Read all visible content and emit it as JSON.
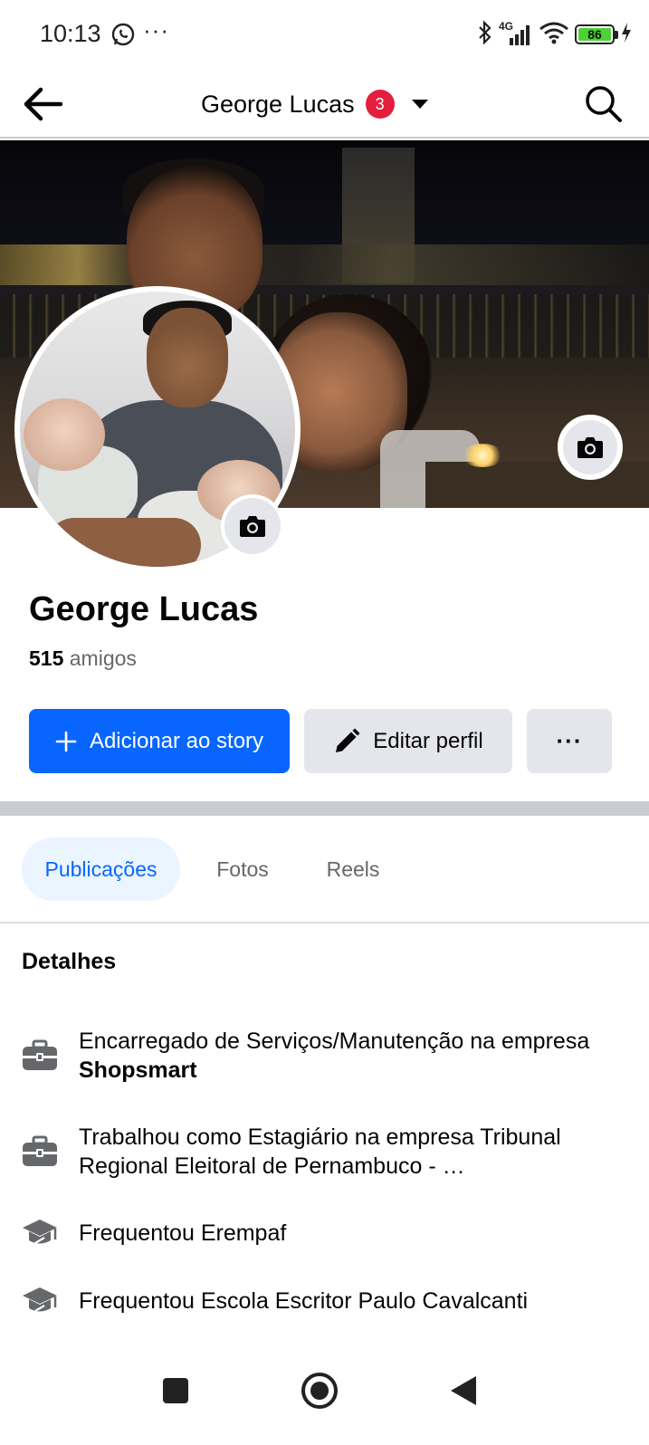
{
  "status_bar": {
    "time": "10:13",
    "network": "4G",
    "battery": "86"
  },
  "header": {
    "title": "George Lucas",
    "badge_count": "3"
  },
  "profile": {
    "name": "George Lucas",
    "friends_count": "515",
    "friends_label": "amigos"
  },
  "actions": {
    "add_story_label": "Adicionar ao story",
    "edit_profile_label": "Editar perfil",
    "more_label": "···"
  },
  "tabs": [
    {
      "label": "Publicações",
      "active": true
    },
    {
      "label": "Fotos",
      "active": false
    },
    {
      "label": "Reels",
      "active": false
    }
  ],
  "details": {
    "title": "Detalhes",
    "items": [
      {
        "icon": "briefcase-icon",
        "text": "Encarregado de Serviços/Manutenção na empresa ",
        "bold": "Shopsmart"
      },
      {
        "icon": "briefcase-icon",
        "text": "Trabalhou como Estagiário na empresa Tribunal Regional Eleitoral de Pernambuco - …",
        "bold": ""
      },
      {
        "icon": "graduation-cap-icon",
        "text": "Frequentou Erempaf",
        "bold": ""
      },
      {
        "icon": "graduation-cap-icon",
        "text": "Frequentou Escola Escritor Paulo Cavalcanti",
        "bold": ""
      }
    ]
  },
  "colors": {
    "primary": "#0866ff",
    "badge": "#e41e3f",
    "secondary_button": "#e4e6eb",
    "tab_active_bg": "#ebf5ff",
    "muted_text": "#65676b"
  }
}
